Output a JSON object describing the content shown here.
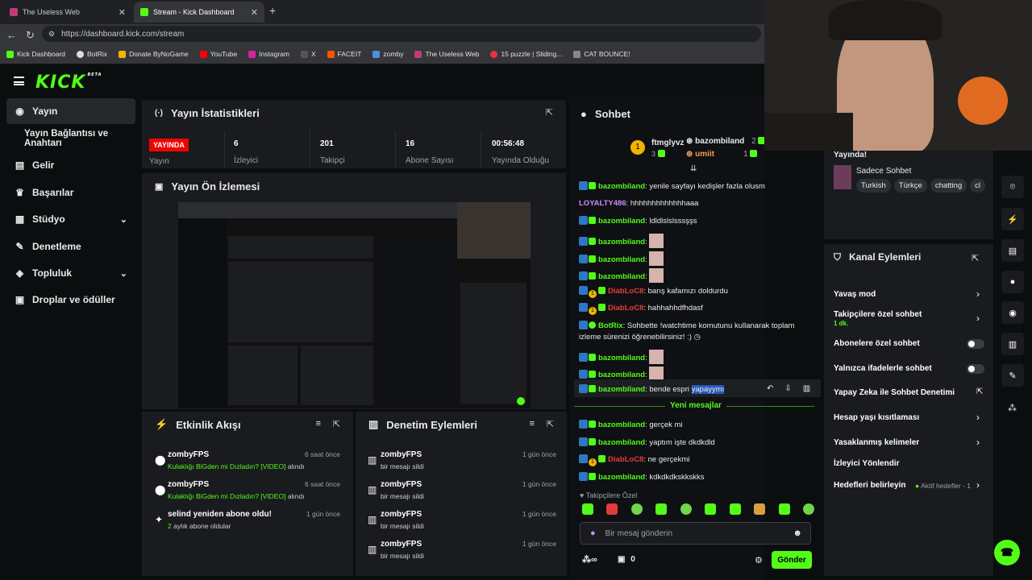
{
  "browser": {
    "tabs": [
      {
        "title": "The Useless Web"
      },
      {
        "title": "Stream - Kick Dashboard"
      }
    ],
    "url": "https://dashboard.kick.com/stream",
    "bookmarks": [
      "Kick Dashboard",
      "BotRix",
      "Donate ByNoGame",
      "YouTube",
      "Instagram",
      "X",
      "FACEIT",
      "zomby",
      "The Useless Web",
      "15 puzzle | Sliding...",
      "CAT BOUNCE!"
    ]
  },
  "app": {
    "logo": "KICK",
    "logo_sup": "BETA"
  },
  "sidebar": {
    "items": [
      {
        "label": "Yayın"
      },
      {
        "label": "Yayın Bağlantısı ve Anahtarı"
      },
      {
        "label": "Gelir"
      },
      {
        "label": "Başarılar"
      },
      {
        "label": "Stüdyo"
      },
      {
        "label": "Denetleme"
      },
      {
        "label": "Topluluk"
      },
      {
        "label": "Droplar ve ödüller"
      }
    ]
  },
  "stats": {
    "title": "Yayın İstatistikleri",
    "live_badge": "YAYINDA",
    "live_label": "Yayın",
    "items": [
      {
        "value": "6",
        "label": "İzleyici"
      },
      {
        "value": "201",
        "label": "Takipçi"
      },
      {
        "value": "16",
        "label": "Abone Sayısı"
      },
      {
        "value": "00:56:48",
        "label": "Yayında Olduğu"
      }
    ]
  },
  "preview": {
    "title": "Yayın Ön İzlemesi"
  },
  "activity": {
    "title": "Etkinlik Akışı",
    "rows": [
      {
        "user": "zombyFPS",
        "highlight": "Kulaklığı BiGden mi Dızladın? [VIDEO]",
        "suffix": " alındı",
        "time": "6 saat önce"
      },
      {
        "user": "zombyFPS",
        "highlight": "Kulaklığı BiGden mi Dızladın? [VIDEO]",
        "suffix": " alındı",
        "time": "6 saat önce"
      },
      {
        "user": "selind yeniden abone oldu!",
        "highlight": "2",
        "suffix": " aylık abone oldular",
        "time": "1 gün önce"
      }
    ]
  },
  "moderation": {
    "title": "Denetim Eylemleri",
    "rows": [
      {
        "user": "zombyFPS",
        "text": "bir mesajı sildi",
        "time": "1 gün önce"
      },
      {
        "user": "zombyFPS",
        "text": "bir mesajı sildi",
        "time": "1 gün önce"
      },
      {
        "user": "zombyFPS",
        "text": "bir mesajı sildi",
        "time": "1 gün önce"
      },
      {
        "user": "zombyFPS",
        "text": "bir mesajı sildi",
        "time": "1 gün önce"
      }
    ]
  },
  "chat": {
    "title": "Sohbet",
    "leaders": [
      {
        "name": "ftmglyvz",
        "count": "3"
      },
      {
        "name": "bazombiland",
        "count": "2"
      },
      {
        "name": "umiit",
        "count": "1"
      }
    ],
    "messages": [
      {
        "user": "bazombiland",
        "text": ": yenile sayfayı kedişler fazla olusm"
      },
      {
        "user": "LOYALTY486",
        "text": ": hhhhhhhhhhhhhaaa"
      },
      {
        "user": "bazombiland",
        "text": ": ldldlslslsssşşs"
      },
      {
        "user": "bazombiland",
        "text": ":"
      },
      {
        "user": "bazombiland",
        "text": ":"
      },
      {
        "user": "bazombiland",
        "text": ":"
      },
      {
        "user": "DiabLoC8",
        "text": ": barış kafamızı doldurdu"
      },
      {
        "user": "DiabLoC8",
        "text": ": hahhahhdfhdasf"
      },
      {
        "user": "BotRix",
        "text": ": Sohbette !watchtime komutunu kullanarak toplam"
      },
      {
        "user": "",
        "text": "izleme sürenizi öğrenebilirsiniz! :)"
      },
      {
        "user": "bazombiland",
        "text": ":"
      },
      {
        "user": "bazombiland",
        "text": ":"
      },
      {
        "user": "bazombiland",
        "text": ": bende espri ",
        "highlight": "yapayymı"
      },
      {
        "user": "bazombiland",
        "text": ": gerçek mi"
      },
      {
        "user": "bazombiland",
        "text": ": yaptım işte dkdkdld"
      },
      {
        "user": "DiabLoC8",
        "text": ": ne gerçekmi"
      },
      {
        "user": "bazombiland",
        "text": ": kdkdkdkskkskks"
      }
    ],
    "new_messages": "Yeni mesajlar",
    "followers_only": "Takipçilere Özel",
    "input_placeholder": "Bir mesaj gönderin",
    "count": "0",
    "send": "Gönder"
  },
  "stream_info": {
    "status": "Yayında!",
    "category": "Sadece Sohbet",
    "tags": [
      "Turkish",
      "Türkçe",
      "chatting",
      "cl"
    ]
  },
  "channel_actions": {
    "title": "Kanal Eylemleri",
    "items": [
      {
        "label": "Yavaş mod"
      },
      {
        "label": "Takipçilere özel sohbet",
        "sub": "1 dk."
      },
      {
        "label": "Abonelere özel sohbet"
      },
      {
        "label": "Yalnızca ifadelerle sohbet"
      },
      {
        "label": "Yapay Zeka ile Sohbet Denetimi"
      },
      {
        "label": "Hesap yaşı kısıtlaması"
      },
      {
        "label": "Yasaklanmış kelimeler"
      },
      {
        "label": "İzleyici Yönlendir"
      },
      {
        "label": "Hedefleri belirleyin",
        "status": "Aktif hedefler - 1"
      }
    ]
  },
  "colors": {
    "accent": "#53fc18",
    "live": "#eb0400",
    "panel": "#191b1f"
  }
}
